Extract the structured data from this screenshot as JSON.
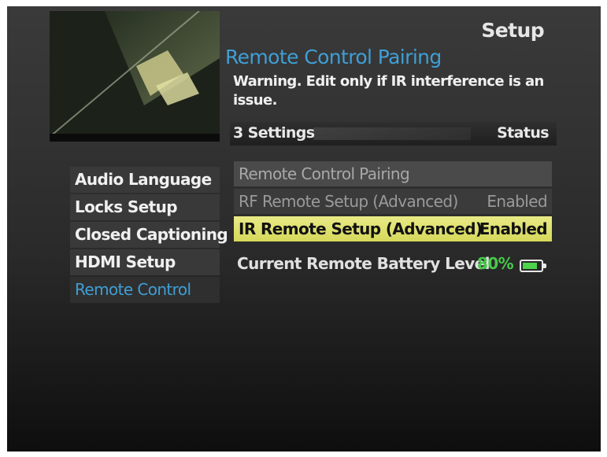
{
  "header": {
    "page_title": "Setup",
    "section_title": "Remote Control Pairing",
    "warning": "Warning. Edit only if IR interference is an issue."
  },
  "settings_header": {
    "count_label": "3 Settings",
    "status_label": "Status"
  },
  "left_menu": {
    "items": [
      {
        "label": "Audio Language"
      },
      {
        "label": "Locks Setup"
      },
      {
        "label": "Closed Captioning"
      },
      {
        "label": "HDMI Setup"
      },
      {
        "label": "Remote Control",
        "active": true
      }
    ]
  },
  "options": [
    {
      "label": "Remote Control Pairing",
      "value": ""
    },
    {
      "label": "RF Remote Setup (Advanced)",
      "value": "Enabled"
    },
    {
      "label": "IR Remote Setup (Advanced)",
      "value": "Enabled",
      "selected": true
    }
  ],
  "battery": {
    "label": "Current Remote Battery Level",
    "level_text": "80%",
    "level": 0.8,
    "color": "#48c84a"
  },
  "colors": {
    "accent": "#3f9fd6",
    "highlight": "#e2e374"
  }
}
